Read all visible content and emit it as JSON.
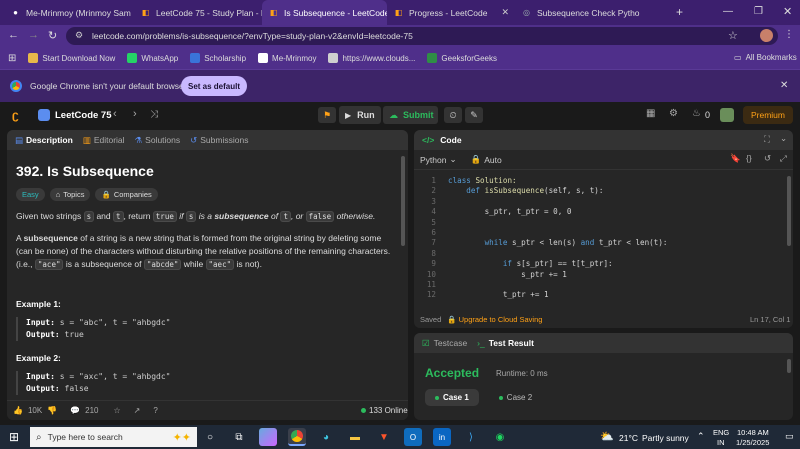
{
  "tabs": [
    {
      "title": "Me-Mrinmoy (Mrinmoy Sam",
      "icon_color": "#ffffff"
    },
    {
      "title": "LeetCode 75 - Study Plan - L",
      "icon_color": "#ffa116"
    },
    {
      "title": "Is Subsequence - LeetCode",
      "icon_color": "#ffa116"
    },
    {
      "title": "Progress - LeetCode",
      "icon_color": "#ffa116"
    },
    {
      "title": "Subsequence Check Python",
      "icon_color": "#9aa"
    }
  ],
  "active_tab": 2,
  "address": {
    "url": "leetcode.com/problems/is-subsequence/?envType=study-plan-v2&envId=leetcode-75"
  },
  "bookmarks": [
    {
      "label": "Start Download Now",
      "color": "#e8b84a"
    },
    {
      "label": "WhatsApp",
      "color": "#25d366"
    },
    {
      "label": "Scholarship",
      "color": "#3a73d9"
    },
    {
      "label": "Me-Mrinmoy",
      "color": "#ffffff"
    },
    {
      "label": "https://www.clouds...",
      "color": "#cfcfcf"
    },
    {
      "label": "GeeksforGeeks",
      "color": "#2f8d46"
    }
  ],
  "bookmarks_all": "All Bookmarks",
  "default_bar": {
    "message": "Google Chrome isn't your default browser",
    "button": "Set as default"
  },
  "lc": {
    "title": "LeetCode 75",
    "run": "Run",
    "submit": "Submit",
    "coins": "0",
    "premium": "Premium"
  },
  "desc_tabs": [
    "Description",
    "Editorial",
    "Solutions",
    "Submissions"
  ],
  "problem": {
    "title": "392. Is Subsequence",
    "difficulty": "Easy",
    "chips": [
      "Topics",
      "Companies"
    ],
    "p1": {
      "a": "Given two strings ",
      "s": "s",
      "b": " and ",
      "t": "t",
      "c": ", return ",
      "true": "true",
      "d": " if ",
      "s2": "s",
      "e": " is a ",
      "sub": "subsequence",
      "f": " of ",
      "t2": "t",
      "g": ", or ",
      "false": "false",
      "h": " otherwise."
    },
    "p2a": "A ",
    "p2b": "subsequence",
    "p2c": " of a string is a new string that is formed from the original string by deleting some (can be none) of the characters without disturbing the relative positions of the remaining characters. (i.e., ",
    "p2d": "\"ace\"",
    "p2e": " is a subsequence of ",
    "p2f": "\"abcde\"",
    "p2g": " while ",
    "p2h": "\"aec\"",
    "p2i": " is not).",
    "examples": [
      {
        "title": "Example 1:",
        "input_label": "Input:",
        "input": " s = \"abc\", t = \"ahbgdc\"",
        "output_label": "Output:",
        "output": " true"
      },
      {
        "title": "Example 2:",
        "input_label": "Input:",
        "input": " s = \"axc\", t = \"ahbgdc\"",
        "output_label": "Output:",
        "output": " false"
      }
    ]
  },
  "desc_footer": {
    "likes": "10K",
    "comments": "210",
    "online": "133 Online"
  },
  "code": {
    "header": "Code",
    "language": "Python",
    "auto": "Auto",
    "lines": [
      [
        {
          "t": "class ",
          "c": "kw"
        },
        {
          "t": "Solution:",
          "c": "fn"
        }
      ],
      [
        {
          "t": "    def ",
          "c": "kw"
        },
        {
          "t": "isSubsequence",
          "c": "fn"
        },
        {
          "t": "(self, s, t):",
          "c": "plain"
        }
      ],
      [],
      [
        {
          "t": "        s_ptr, t_ptr = 0, 0",
          "c": "plain"
        }
      ],
      [],
      [],
      [
        {
          "t": "        while ",
          "c": "kw"
        },
        {
          "t": "s_ptr < len(s) ",
          "c": "plain"
        },
        {
          "t": "and ",
          "c": "kw"
        },
        {
          "t": "t_ptr < len(t):",
          "c": "plain"
        }
      ],
      [],
      [
        {
          "t": "            if ",
          "c": "kw"
        },
        {
          "t": "s[s_ptr] == t[t_ptr]:",
          "c": "plain"
        }
      ],
      [
        {
          "t": "                s_ptr += 1",
          "c": "plain"
        }
      ],
      [],
      [
        {
          "t": "            t_ptr += 1",
          "c": "plain"
        }
      ]
    ],
    "line_numbers": [
      "1",
      "2",
      "3",
      "4",
      "5",
      "6",
      "7",
      "8",
      "9",
      "10",
      "11",
      "12"
    ],
    "saved": "Saved",
    "upgrade": "Upgrade to Cloud Saving",
    "position": "Ln 17, Col 1"
  },
  "result": {
    "tabs": [
      "Testcase",
      "Test Result"
    ],
    "status": "Accepted",
    "runtime": "Runtime: 0 ms",
    "cases": [
      "Case 1",
      "Case 2"
    ]
  },
  "taskbar": {
    "search": "Type here to search",
    "temp": "21°C",
    "weather": "Partly sunny",
    "lang1": "ENG",
    "lang2": "IN",
    "time": "10:48 AM",
    "date": "1/25/2025"
  }
}
